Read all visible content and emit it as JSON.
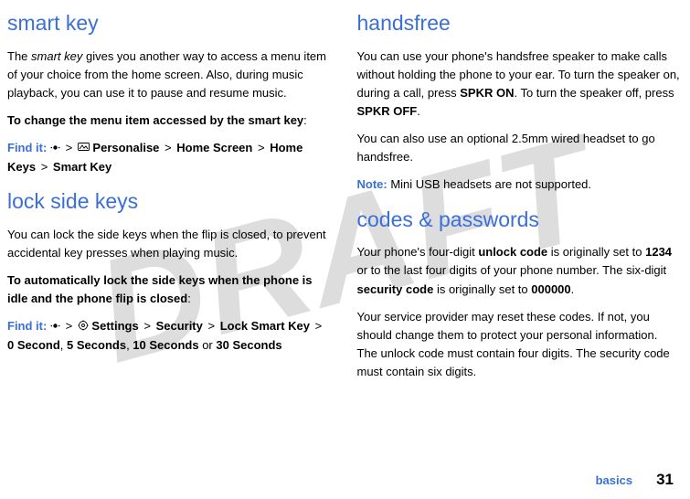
{
  "watermark": "DRAFT",
  "left": {
    "sec1": {
      "title": "smart key",
      "p1a": "The ",
      "p1_em": "smart key",
      "p1b": " gives you another way to access a menu item of your choice from the home screen. Also, during music playback, you can use it to pause and resume music.",
      "p2": "To change the menu item accessed by the smart key",
      "findit": "Find it:",
      "chain": {
        "c1": "Personalise",
        "c2": "Home Screen",
        "c3": "Home Keys",
        "c4": "Smart Key"
      }
    },
    "sec2": {
      "title": "lock side keys",
      "p1": "You can lock the side keys when the flip is closed, to prevent accidental key presses when playing music.",
      "p2": "To automatically lock the side keys when the phone is idle and the phone flip is closed",
      "findit": "Find it:",
      "chain": {
        "c1": "Settings",
        "c2": "Security",
        "c3": "Lock Smart Key",
        "c4": "0 Second",
        "c5": "5 Seconds",
        "c6": "10 Seconds",
        "or": "or",
        "c7": "30 Seconds"
      }
    }
  },
  "right": {
    "sec1": {
      "title": "handsfree",
      "p1a": "You can use your phone's handsfree speaker to make calls without holding the phone to your ear. To turn the speaker on, during a call, press  ",
      "k1": "SPKR ON",
      "p1b": ". To turn the speaker off, press ",
      "k2": "SPKR OFF",
      "p1c": ".",
      "p2": "You can also use an optional 2.5mm wired headset to go handsfree.",
      "note_label": "Note:",
      "note_text": " Mini USB headsets are not supported."
    },
    "sec2": {
      "title": "codes & passwords",
      "p1a": "Your phone's four-digit ",
      "b1": "unlock code",
      "p1b": " is originally set to ",
      "b2": "1234",
      "p1c": " or to the last four digits of your phone number. The six-digit ",
      "b3": "security code",
      "p1d": " is originally set to ",
      "b4": "000000",
      "p1e": ".",
      "p2": "Your service provider may reset these codes. If not, you should change them to protect your personal information. The unlock code must contain four digits. The security code must contain six digits."
    }
  },
  "footer": {
    "label": "basics",
    "page": "31"
  }
}
